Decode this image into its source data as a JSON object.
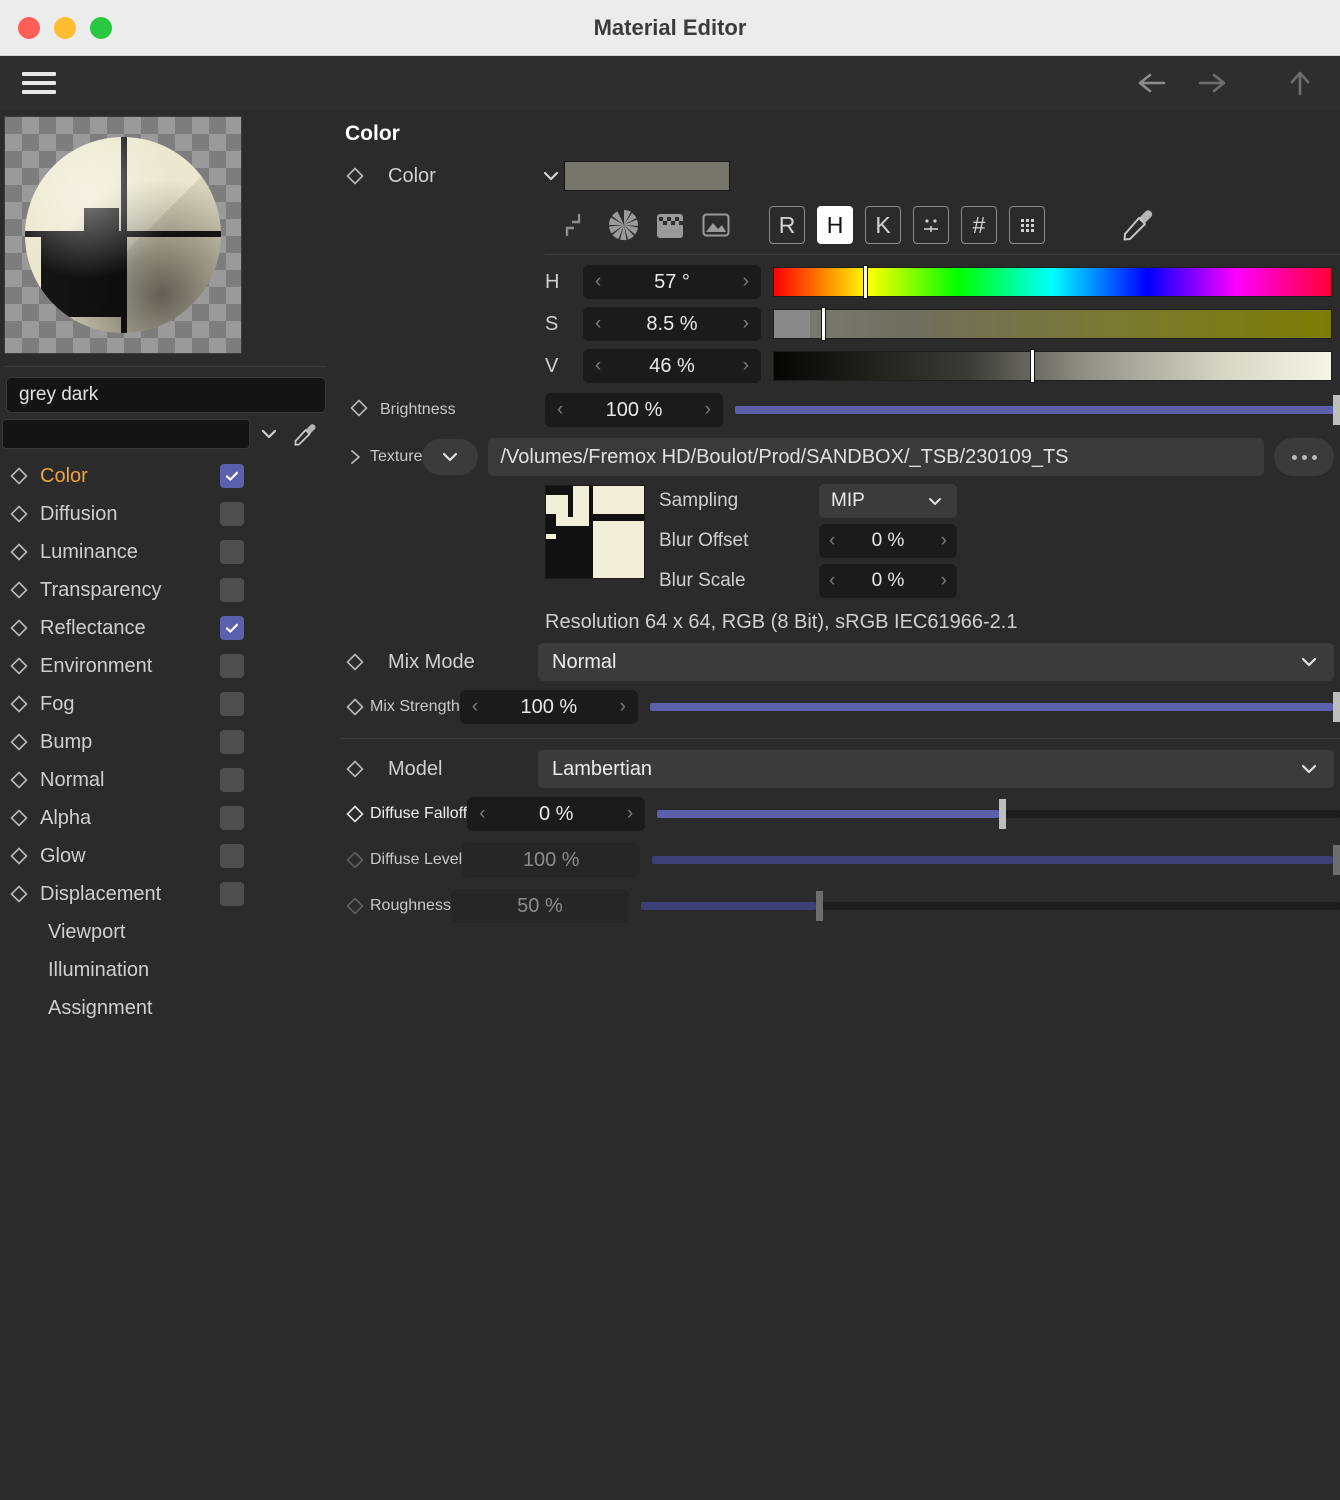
{
  "window": {
    "title": "Material Editor",
    "traffic_lights": [
      "close",
      "minimize",
      "zoom"
    ]
  },
  "toolbar": {
    "menu_icon": "hamburger-icon",
    "back_icon": "arrow-left-icon",
    "forward_icon": "arrow-right-icon",
    "up_icon": "arrow-up-icon"
  },
  "sidebar": {
    "material_name": "grey dark",
    "layer_value": "",
    "channels": [
      {
        "label": "Color",
        "checked": true,
        "active": true,
        "has_diamond": true
      },
      {
        "label": "Diffusion",
        "checked": false,
        "active": false,
        "has_diamond": true
      },
      {
        "label": "Luminance",
        "checked": false,
        "active": false,
        "has_diamond": true
      },
      {
        "label": "Transparency",
        "checked": false,
        "active": false,
        "has_diamond": true
      },
      {
        "label": "Reflectance",
        "checked": true,
        "active": false,
        "has_diamond": true
      },
      {
        "label": "Environment",
        "checked": false,
        "active": false,
        "has_diamond": true
      },
      {
        "label": "Fog",
        "checked": false,
        "active": false,
        "has_diamond": true
      },
      {
        "label": "Bump",
        "checked": false,
        "active": false,
        "has_diamond": true
      },
      {
        "label": "Normal",
        "checked": false,
        "active": false,
        "has_diamond": true
      },
      {
        "label": "Alpha",
        "checked": false,
        "active": false,
        "has_diamond": true
      },
      {
        "label": "Glow",
        "checked": false,
        "active": false,
        "has_diamond": true
      },
      {
        "label": "Displacement",
        "checked": false,
        "active": false,
        "has_diamond": true
      },
      {
        "label": "Viewport",
        "checked": null,
        "active": false,
        "has_diamond": false
      },
      {
        "label": "Illumination",
        "checked": null,
        "active": false,
        "has_diamond": false
      },
      {
        "label": "Assignment",
        "checked": null,
        "active": false,
        "has_diamond": false
      }
    ]
  },
  "content": {
    "section_title": "Color",
    "color_row_label": "Color",
    "color_swatch_hex": "#75756c",
    "mode_buttons": [
      {
        "label": "R",
        "active": false,
        "name": "rgb-mode-button"
      },
      {
        "label": "H",
        "active": true,
        "name": "hsv-mode-button"
      },
      {
        "label": "K",
        "active": false,
        "name": "kelvin-mode-button"
      },
      {
        "label": "",
        "active": false,
        "name": "spectrum-mode-button"
      },
      {
        "label": "#",
        "active": false,
        "name": "hex-mode-button"
      },
      {
        "label": "",
        "active": false,
        "name": "swatches-mode-button"
      }
    ],
    "hsv": [
      {
        "key": "H",
        "value": "57 °",
        "pos": 16
      },
      {
        "key": "S",
        "value": "8.5 %",
        "pos": 8.5
      },
      {
        "key": "V",
        "value": "46 %",
        "pos": 46
      }
    ],
    "brightness": {
      "label": "Brightness",
      "value": "100 %",
      "pos": 100
    },
    "texture": {
      "label": "Texture",
      "path": "/Volumes/Fremox HD/Boulot/Prod/SANDBOX/_TSB/230109_TS",
      "sampling_label": "Sampling",
      "sampling_value": "MIP",
      "blur_offset_label": "Blur Offset",
      "blur_offset_value": "0 %",
      "blur_scale_label": "Blur Scale",
      "blur_scale_value": "0 %",
      "resolution_text": "Resolution 64 x 64, RGB (8 Bit), sRGB IEC61966-2.1"
    },
    "mix_mode": {
      "label": "Mix Mode",
      "value": "Normal"
    },
    "mix_strength": {
      "label": "Mix Strength",
      "value": "100 %",
      "pos": 100
    },
    "model": {
      "label": "Model",
      "value": "Lambertian"
    },
    "diffuse_falloff": {
      "label": "Diffuse Falloff",
      "value": "0 %",
      "pos": 50,
      "disabled": false
    },
    "diffuse_level": {
      "label": "Diffuse Level",
      "value": "100 %",
      "pos": 100,
      "disabled": true
    },
    "roughness": {
      "label": "Roughness",
      "value": "50 %",
      "pos": 25,
      "disabled": true
    }
  }
}
